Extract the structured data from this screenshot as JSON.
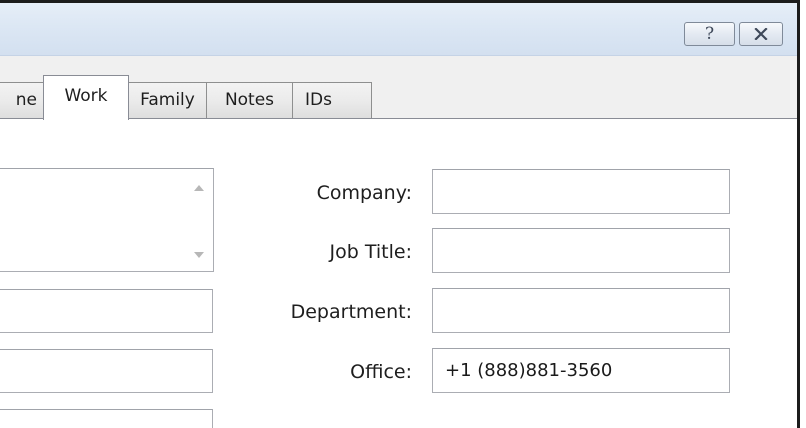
{
  "title_bar": {
    "help_glyph": "?",
    "close_icon": "close-icon"
  },
  "tabs": [
    {
      "id": "home",
      "label": "ne",
      "selected": false
    },
    {
      "id": "work",
      "label": "Work",
      "selected": true
    },
    {
      "id": "family",
      "label": "Family",
      "selected": false
    },
    {
      "id": "notes",
      "label": "Notes",
      "selected": false
    },
    {
      "id": "ids",
      "label": "IDs",
      "selected": false
    }
  ],
  "work": {
    "company": {
      "label": "Company:",
      "value": ""
    },
    "job_title": {
      "label": "Job Title:",
      "value": ""
    },
    "department": {
      "label": "Department:",
      "value": ""
    },
    "office": {
      "label": "Office:",
      "value": "+1 (888)881-3560"
    }
  },
  "colors": {
    "title_bar": "#dce7f4",
    "tab_border": "#898c95",
    "field_border": "#abadb3",
    "frame_border": "#1c1c1c"
  }
}
